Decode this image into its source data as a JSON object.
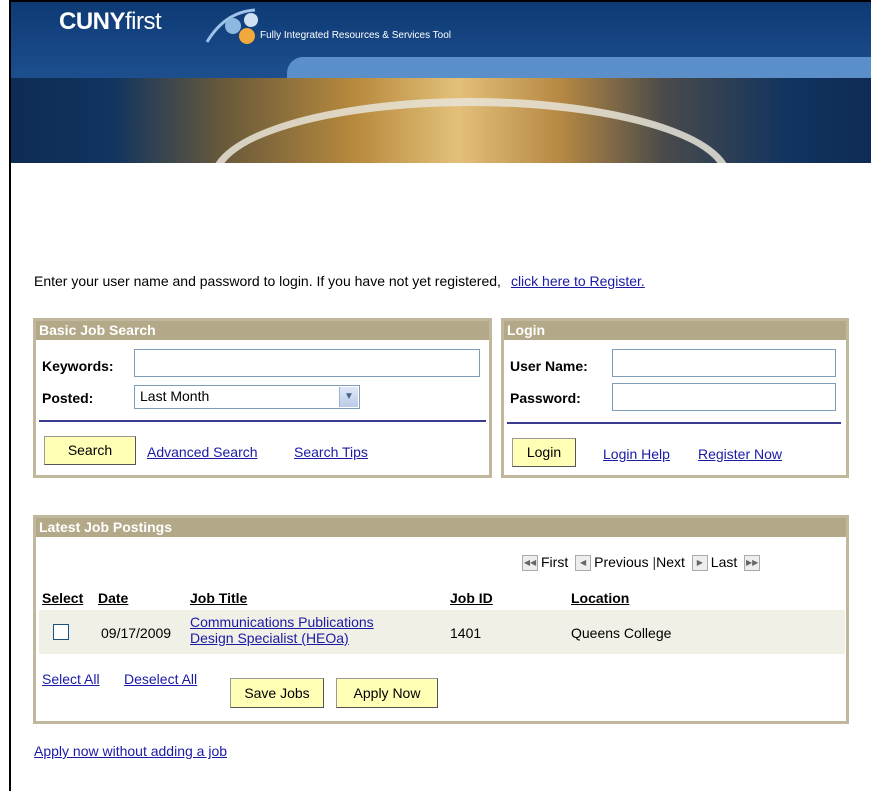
{
  "header": {
    "logo_bold": "CUNY",
    "logo_light": "first",
    "tagline": "Fully Integrated Resources & Services Tool"
  },
  "intro": {
    "text": "Enter your user name and password to login. If you have not yet registered,",
    "register_link": "click here to Register."
  },
  "job_search": {
    "title": "Basic Job Search",
    "keywords_label": "Keywords:",
    "keywords_value": "",
    "posted_label": "Posted:",
    "posted_value": "Last Month",
    "search_button": "Search",
    "advanced_link": "Advanced Search",
    "tips_link": "Search Tips"
  },
  "login": {
    "title": "Login",
    "username_label": "User Name:",
    "username_value": "",
    "password_label": "Password:",
    "password_value": "",
    "login_button": "Login",
    "help_link": "Login Help",
    "register_link": "Register Now"
  },
  "postings": {
    "title": "Latest Job Postings",
    "nav": {
      "first": "First",
      "previous": "Previous",
      "next": "Next",
      "last": "Last"
    },
    "columns": [
      "Select",
      "Date",
      "Job Title",
      "Job ID",
      "Location"
    ],
    "rows": [
      {
        "date": "09/17/2009",
        "title_line1": "Communications Publications",
        "title_line2": "Design Specialist (HEOa)",
        "job_id": "1401",
        "location": "Queens College"
      }
    ],
    "select_all": "Select All",
    "deselect_all": "Deselect All",
    "save_jobs": "Save Jobs",
    "apply_now": "Apply Now"
  },
  "apply_without": "Apply now without adding a job"
}
